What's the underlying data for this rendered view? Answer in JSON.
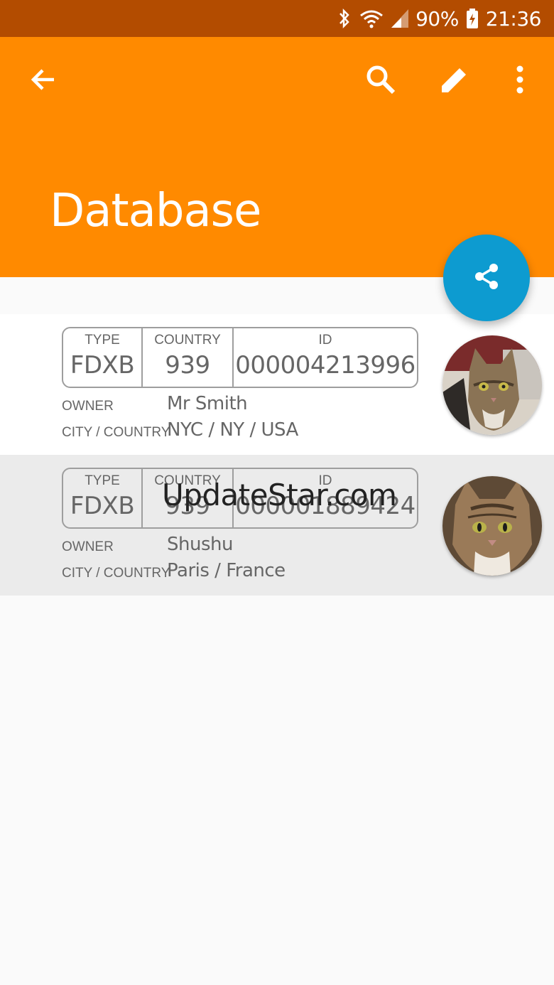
{
  "status_bar": {
    "battery": "90%",
    "time": "21:36"
  },
  "app_bar": {
    "title": "Database",
    "icons": [
      "back-arrow-icon",
      "search-icon",
      "edit-pencil-icon",
      "more-vert-icon"
    ]
  },
  "fab": {
    "icon": "share-icon",
    "color": "#0d9bd0"
  },
  "colors": {
    "primary": "#ff8a00",
    "status_bar": "#b34c00",
    "accent": "#0d9bd0"
  },
  "records": [
    {
      "type_label": "TYPE",
      "type": "FDXB",
      "country_label": "COUNTRY",
      "country": "939",
      "id_label": "ID",
      "id": "000004213996",
      "owner_label": "OWNER",
      "owner": "Mr Smith",
      "city_label": "CITY / COUNTRY",
      "city": "NYC / NY / USA"
    },
    {
      "type_label": "TYPE",
      "type": "FDXB",
      "country_label": "COUNTRY",
      "country": "939",
      "id_label": "ID",
      "id": "000001889424",
      "owner_label": "OWNER",
      "owner": "Shushu",
      "city_label": "CITY / COUNTRY",
      "city": "Paris / France"
    }
  ],
  "watermark": "UpdateStar.com"
}
